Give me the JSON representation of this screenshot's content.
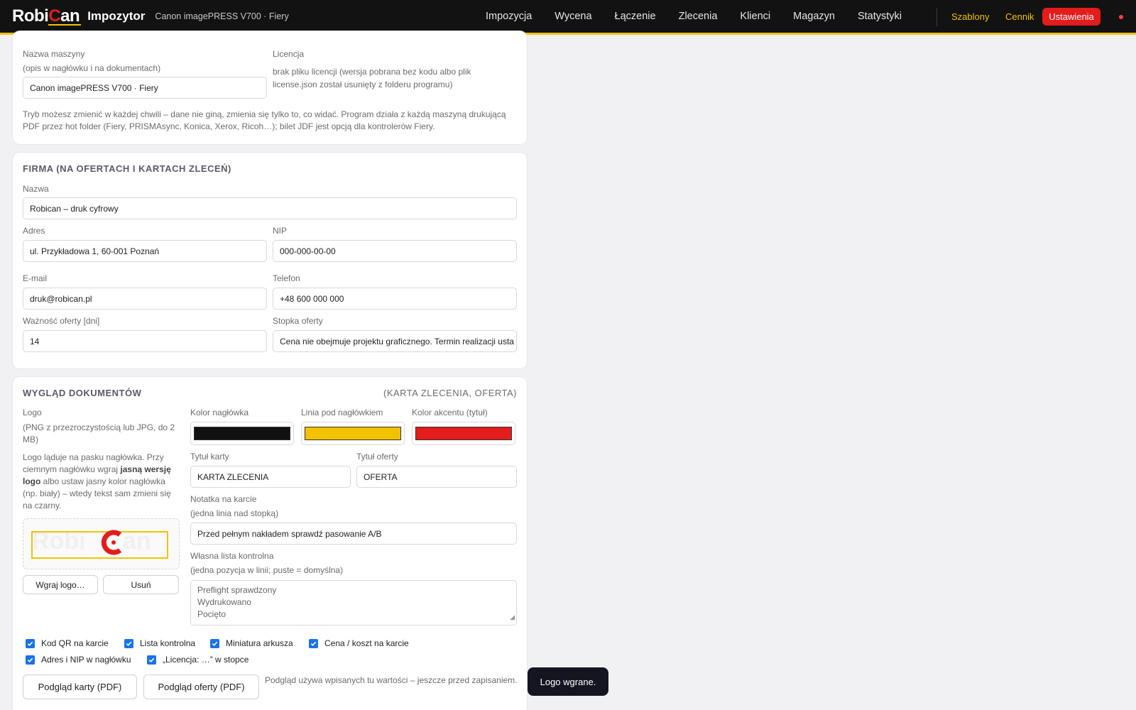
{
  "topbar": {
    "logo_prefix": "Robi",
    "logo_accent": "C",
    "logo_suffix": "an",
    "app_title": "Impozytor",
    "machine": "Canon imagePRESS V700 · Fiery",
    "nav": [
      "Impozycja",
      "Wycena",
      "Łączenie",
      "Zlecenia",
      "Klienci",
      "Magazyn",
      "Statystyki"
    ],
    "link_templates": "Szablony",
    "link_pricelist": "Cennik",
    "settings_button": "Ustawienia",
    "colors": {
      "accent_yellow": "#f2c200",
      "accent_red": "#e31c1c"
    }
  },
  "machine_card": {
    "name_label": "Nazwa maszyny",
    "name_hint": "(opis w nagłówku i na dokumentach)",
    "name_value": "Canon imagePRESS V700 · Fiery",
    "license_label": "Licencja",
    "license_text_1": "brak pliku licencji (wersja pobrana bez kodu albo plik",
    "license_text_2": "license.json został usunięty z folderu programu)",
    "mode_note_1": "Tryb możesz zmienić w każdej chwili – dane nie giną, zmienia się tylko to, co widać. Program działa z każdą maszyną drukującą",
    "mode_note_2": "PDF przez hot folder (Fiery, PRISMAsync, Konica, Xerox, Ricoh…); bilet JDF jest opcją dla kontrolerów Fiery."
  },
  "company_card": {
    "title": "FIRMA (NA OFERTACH I KARTACH ZLECEŃ)",
    "name_label": "Nazwa",
    "name_value": "Robican – druk cyfrowy",
    "address_label": "Adres",
    "address_value": "ul. Przykładowa 1, 60-001 Poznań",
    "nip_label": "NIP",
    "nip_value": "000-000-00-00",
    "email_label": "E-mail",
    "email_value": "druk@robican.pl",
    "phone_label": "Telefon",
    "phone_value": "+48 600 000 000",
    "validity_label": "Ważność oferty [dni]",
    "validity_value": "14",
    "footer_label": "Stopka oferty",
    "footer_value": "Cena nie obejmuje projektu graficznego. Termin realizacji usta"
  },
  "docs_card": {
    "title": "WYGLĄD DOKUMENTÓW",
    "subtitle": "(KARTA ZLECENIA, OFERTA)",
    "logo_label": "Logo",
    "logo_hint_1": "(PNG z przezroczystością lub JPG, do 2",
    "logo_hint_2": "MB)",
    "logo_note_1": "Logo ląduje na pasku nagłówka. Przy",
    "logo_note_2a": "ciemnym nagłówku wgraj ",
    "logo_note_2b": "jasną wersję",
    "logo_note_3a": "logo",
    "logo_note_3b": " albo ustaw jasny kolor nagłówka",
    "logo_note_4": "(np. biały) – wtedy tekst sam zmieni się",
    "logo_note_5": "na czarny.",
    "upload_button": "Wgraj logo…",
    "remove_button": "Usuń",
    "header_color_label": "Kolor nagłówka",
    "header_color": "#111111",
    "line_color_label": "Linia pod nagłówkiem",
    "line_color": "#f2c200",
    "accent_color_label": "Kolor akcentu (tytuł)",
    "accent_color": "#e31c1c",
    "card_title_label": "Tytuł karty",
    "card_title_value": "KARTA ZLECENIA",
    "offer_title_label": "Tytuł oferty",
    "offer_title_value": "OFERTA",
    "card_note_label": "Notatka na karcie",
    "card_note_hint": "(jedna linia nad stopką)",
    "card_note_value": "Przed pełnym nakładem sprawdź pasowanie A/B",
    "checklist_label": "Własna lista kontrolna",
    "checklist_hint": "(jedna pozycja w linii; puste = domyślna)",
    "checklist_lines": [
      "Preflight sprawdzony",
      "Wydrukowano",
      "Pocięto"
    ],
    "checkboxes": [
      {
        "label": "Kod QR na karcie",
        "checked": true
      },
      {
        "label": "Lista kontrolna",
        "checked": true
      },
      {
        "label": "Miniatura arkusza",
        "checked": true
      },
      {
        "label": "Cena / koszt na karcie",
        "checked": true
      },
      {
        "label": "Adres i NIP w nagłówku",
        "checked": true
      },
      {
        "label": "„Licencja: …” w stopce",
        "checked": true
      }
    ],
    "preview_card_button": "Podgląd karty (PDF)",
    "preview_offer_button": "Podgląd oferty (PDF)",
    "preview_note": "Podgląd używa wpisanych tu wartości – jeszcze przed zapisaniem."
  },
  "toast": "Logo wgrane."
}
